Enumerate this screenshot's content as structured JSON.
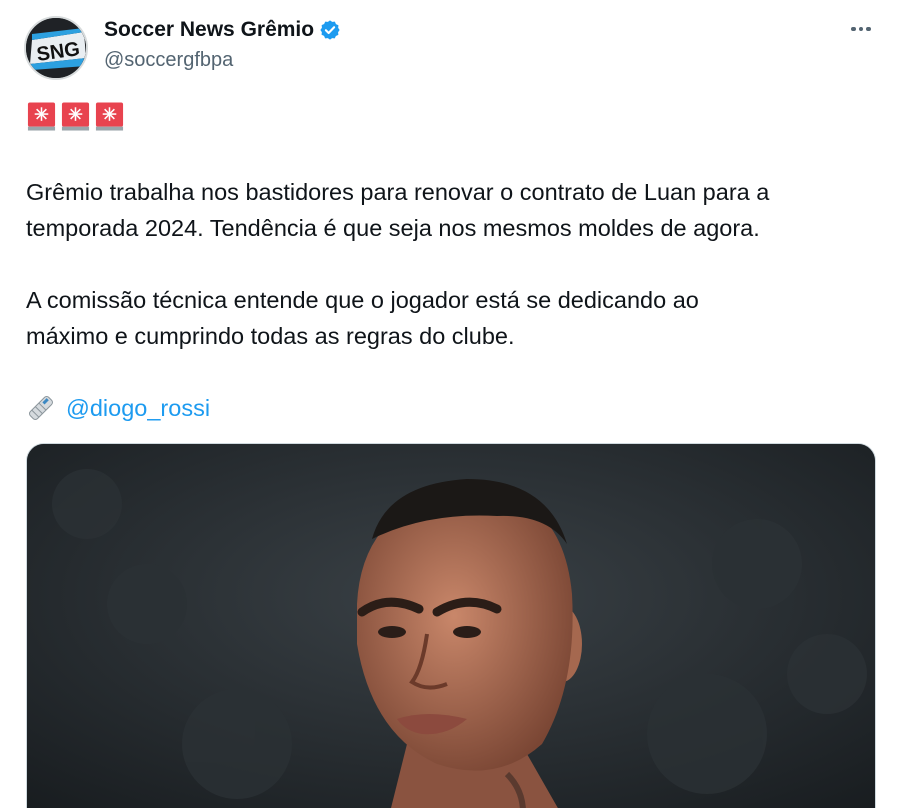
{
  "author": {
    "display_name": "Soccer News Grêmio",
    "handle": "@soccergfbpa",
    "avatar_text": "SNG",
    "verified_icon": "verified-badge-icon",
    "verified_color": "#1d9bf0"
  },
  "menu": {
    "icon": "more-horizontal-icon"
  },
  "tweet": {
    "emoji_line": [
      "siren-icon",
      "siren-icon",
      "siren-icon"
    ],
    "paragraph_1_line_1": "Grêmio trabalha nos bastidores para renovar o contrato de Luan para a",
    "paragraph_1_line_2": "temporada 2024. Tendência é que seja nos mesmos moldes de agora.",
    "paragraph_2_line_1": "A comissão técnica entende que o jogador está se dedicando ao",
    "paragraph_2_line_2": "máximo e cumprindo todas as regras do clube.",
    "credit_icon": "rolled-newspaper-icon",
    "credit_mention": "@diogo_rossi",
    "link_color": "#1d9bf0"
  },
  "media": {
    "image": "photo-of-player-icon"
  }
}
